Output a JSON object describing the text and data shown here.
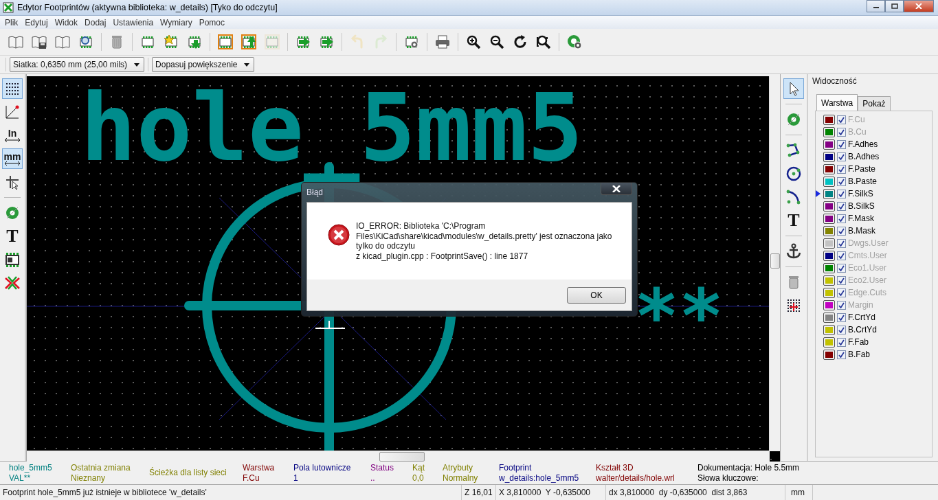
{
  "window": {
    "title": "Edytor Footprintów (aktywna biblioteka: w_details) [Tyko do odczytu]"
  },
  "menu": [
    "Plik",
    "Edytuj",
    "Widok",
    "Dodaj",
    "Ustawienia",
    "Wymiary",
    "Pomoc"
  ],
  "toolbar": [
    [
      {
        "disabled": false
      },
      {
        "disabled": false
      },
      {
        "disabled": false
      },
      {
        "disabled": false
      }
    ],
    [
      {
        "disabled": false
      }
    ],
    [
      {
        "disabled": false
      },
      {
        "disabled": false
      },
      {
        "disabled": false
      }
    ],
    [
      {
        "disabled": false
      },
      {
        "disabled": false
      },
      {
        "disabled": true
      }
    ],
    [
      {
        "disabled": false
      },
      {
        "disabled": false
      }
    ],
    [
      {
        "disabled": true
      },
      {
        "disabled": true
      }
    ],
    [
      {
        "disabled": false
      }
    ],
    [
      {
        "disabled": false
      }
    ],
    [
      {
        "disabled": false
      },
      {
        "disabled": false
      },
      {
        "disabled": false
      },
      {
        "disabled": false
      }
    ],
    [
      {
        "disabled": false
      }
    ]
  ],
  "grid_select": {
    "value": "Siatka: 0,6350 mm (25,00 mils)"
  },
  "zoom_select": {
    "value": "Dopasuj powiększenie"
  },
  "left_toolbar": [
    [
      {
        "selected": true
      },
      {
        "selected": false
      },
      {
        "selected": false,
        "label": "In"
      },
      {
        "selected": true,
        "label": "mm"
      },
      {
        "selected": false
      }
    ],
    [
      {
        "selected": false
      },
      {
        "selected": false,
        "label": "T"
      },
      {
        "selected": false
      },
      {
        "selected": false
      }
    ]
  ],
  "canvas": {
    "reference": "hole_5mm5",
    "value": "**"
  },
  "right_toolbar": [
    [
      {
        "selected": true
      }
    ],
    [
      {
        "selected": false
      }
    ],
    [
      {
        "selected": false
      },
      {
        "selected": false
      },
      {
        "selected": false
      },
      {
        "selected": false,
        "label": "T"
      }
    ],
    [
      {
        "selected": false
      }
    ],
    [
      {
        "selected": false
      },
      {
        "selected": false
      }
    ]
  ],
  "visibility": {
    "title": "Widoczność",
    "tabs": [
      {
        "label": "Warstwa",
        "selected": true
      },
      {
        "label": "Pokaż",
        "selected": false
      }
    ],
    "layers": [
      {
        "name": "F.Cu",
        "color": "#840000",
        "checked": true,
        "disabled": true,
        "selected": false
      },
      {
        "name": "B.Cu",
        "color": "#008400",
        "checked": true,
        "disabled": true,
        "selected": false
      },
      {
        "name": "F.Adhes",
        "color": "#840084",
        "checked": true,
        "disabled": false,
        "selected": false
      },
      {
        "name": "B.Adhes",
        "color": "#000084",
        "checked": true,
        "disabled": false,
        "selected": false
      },
      {
        "name": "F.Paste",
        "color": "#840000",
        "checked": true,
        "disabled": false,
        "selected": false
      },
      {
        "name": "B.Paste",
        "color": "#00c2c2",
        "checked": true,
        "disabled": false,
        "selected": false
      },
      {
        "name": "F.SilkS",
        "color": "#008484",
        "checked": true,
        "disabled": false,
        "selected": true
      },
      {
        "name": "B.SilkS",
        "color": "#840084",
        "checked": true,
        "disabled": false,
        "selected": false
      },
      {
        "name": "F.Mask",
        "color": "#840084",
        "checked": true,
        "disabled": false,
        "selected": false
      },
      {
        "name": "B.Mask",
        "color": "#848400",
        "checked": true,
        "disabled": false,
        "selected": false
      },
      {
        "name": "Dwgs.User",
        "color": "#c2c2c2",
        "checked": true,
        "disabled": true,
        "selected": false
      },
      {
        "name": "Cmts.User",
        "color": "#000084",
        "checked": true,
        "disabled": true,
        "selected": false
      },
      {
        "name": "Eco1.User",
        "color": "#008400",
        "checked": true,
        "disabled": true,
        "selected": false
      },
      {
        "name": "Eco2.User",
        "color": "#c2c200",
        "checked": true,
        "disabled": true,
        "selected": false
      },
      {
        "name": "Edge.Cuts",
        "color": "#c2c200",
        "checked": true,
        "disabled": true,
        "selected": false
      },
      {
        "name": "Margin",
        "color": "#c200c2",
        "checked": true,
        "disabled": true,
        "selected": false
      },
      {
        "name": "F.CrtYd",
        "color": "#848484",
        "checked": true,
        "disabled": false,
        "selected": false
      },
      {
        "name": "B.CrtYd",
        "color": "#c2c200",
        "checked": true,
        "disabled": false,
        "selected": false
      },
      {
        "name": "F.Fab",
        "color": "#c2c200",
        "checked": true,
        "disabled": false,
        "selected": false
      },
      {
        "name": "B.Fab",
        "color": "#840000",
        "checked": true,
        "disabled": false,
        "selected": false
      }
    ]
  },
  "message_panel": [
    {
      "label": "hole_5mm5",
      "value": "VAL**",
      "color": "#008080"
    },
    {
      "label": "Ostatnia zmiana",
      "value": "Nieznany",
      "color": "#808000"
    },
    {
      "label": "Ścieżka dla listy sieci",
      "color": "#808000"
    },
    {
      "label": "Warstwa",
      "value": "F.Cu",
      "color": "#800000"
    },
    {
      "label": "Pola lutownicze",
      "value": "1",
      "color": "#000080"
    },
    {
      "label": "Status",
      "value": "..",
      "color": "#800080"
    },
    {
      "label": "Kąt",
      "value": "0,0",
      "color": "#808000"
    },
    {
      "label": "Atrybuty",
      "value": "Normalny",
      "color": "#808000"
    },
    {
      "label": "Footprint",
      "value": "w_details:hole_5mm5",
      "color": "#000080"
    },
    {
      "label": "Kształt 3D",
      "value": "walter/details/hole.wrl",
      "color": "#800000"
    },
    {
      "label": "Dokumentacja: Hole 5.5mm",
      "value": "Słowa kluczowe:",
      "color": "#000000"
    }
  ],
  "status_bar": [
    "Footprint hole_5mm5 już istnieje w bibliotece 'w_details'",
    "Z 16,01",
    "X 3,810000  Y -0,635000",
    "dx 3,810000  dy -0,635000  dist 3,863",
    "mm"
  ],
  "dialog": {
    "title": "Błąd",
    "message": [
      "IO_ERROR: Biblioteka 'C:\\Program",
      "Files\\KiCad\\share\\kicad\\modules\\w_details.pretty' jest oznaczona jako",
      "tylko do odczytu",
      "z kicad_plugin.cpp : FootprintSave() : line 1877"
    ],
    "button": "OK"
  }
}
